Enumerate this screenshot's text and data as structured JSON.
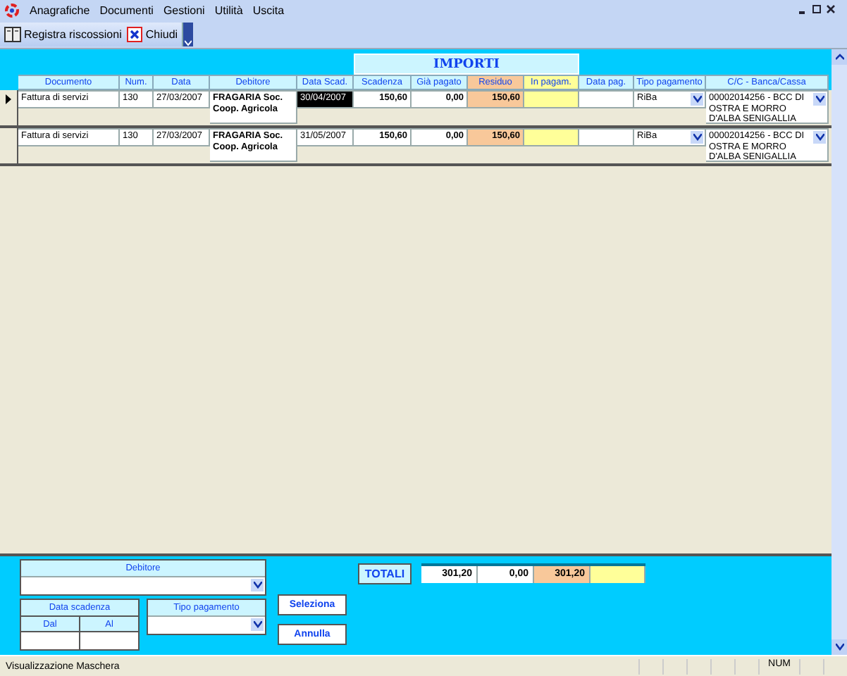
{
  "menu": [
    "Anagrafiche",
    "Documenti",
    "Gestioni",
    "Utilità",
    "Uscita"
  ],
  "toolbar": [
    {
      "kind": "book",
      "label": "Registra riscossioni"
    },
    {
      "kind": "close",
      "label": "Chiudi"
    }
  ],
  "table": {
    "group_header": "IMPORTI",
    "columns": [
      "Documento",
      "Num.",
      "Data",
      "Debitore",
      "Data Scad.",
      "Scadenza",
      "Già pagato",
      "Residuo",
      "In pagam.",
      "Data pag.",
      "Tipo pagamento",
      "C/C - Banca/Cassa"
    ],
    "rows": [
      {
        "selected": true,
        "documento": "Fattura di servizi",
        "num": "130",
        "data": "27/03/2007",
        "debitore": "FRAGARIA Soc. Coop. Agricola",
        "data_scad": "30/04/2007",
        "data_scad_selected": true,
        "scadenza": "150,60",
        "gia_pagato": "0,00",
        "residuo": "150,60",
        "tipo_pagamento": "RiBa",
        "conto": "00002014256 - BCC DI OSTRA E MORRO D'ALBA SENIGALLIA"
      },
      {
        "selected": false,
        "documento": "Fattura di servizi",
        "num": "130",
        "data": "27/03/2007",
        "debitore": "FRAGARIA Soc. Coop. Agricola",
        "data_scad": "31/05/2007",
        "data_scad_selected": false,
        "scadenza": "150,60",
        "gia_pagato": "0,00",
        "residuo": "150,60",
        "tipo_pagamento": "RiBa",
        "conto": "00002014256 - BCC DI OSTRA E MORRO D'ALBA SENIGALLIA"
      }
    ]
  },
  "filters": {
    "debitore": "Debitore",
    "data_scadenza": "Data scadenza",
    "dal": "Dal",
    "al": "Al",
    "tipo_pagamento": "Tipo pagamento"
  },
  "buttons": [
    "Seleziona",
    "Annulla"
  ],
  "totals": {
    "label": "TOTALI",
    "scadenza": "301,20",
    "gia_pagato": "0,00",
    "residuo": "301,20"
  },
  "status_bar": {
    "message": "Visualizzazione Maschera",
    "indicator": "NUM"
  }
}
